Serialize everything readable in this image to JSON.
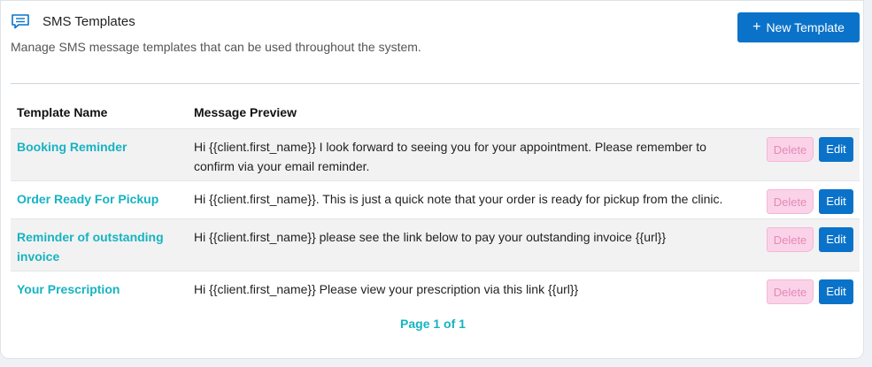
{
  "header": {
    "title": "SMS Templates",
    "subtitle": "Manage SMS message templates that can be used throughout the system.",
    "new_button_label": "New Template",
    "new_button_icon": "plus-icon",
    "title_icon": "message-icon"
  },
  "table": {
    "columns": [
      "Template Name",
      "Message Preview"
    ],
    "rows": [
      {
        "name": "Booking Reminder",
        "preview": "Hi {{client.first_name}} I look forward to seeing you for your appointment. Please remember to confirm via your email reminder.",
        "delete_label": "Delete",
        "edit_label": "Edit"
      },
      {
        "name": "Order Ready For Pickup",
        "preview": "Hi {{client.first_name}}. This is just a quick note that your order is ready for pickup from the clinic.",
        "delete_label": "Delete",
        "edit_label": "Edit"
      },
      {
        "name": "Reminder of outstanding invoice",
        "preview": "Hi {{client.first_name}} please see the link below to pay your outstanding invoice {{url}}",
        "delete_label": "Delete",
        "edit_label": "Edit"
      },
      {
        "name": "Your Prescription",
        "preview": "Hi {{client.first_name}} Please view your prescription via this link {{url}}",
        "delete_label": "Delete",
        "edit_label": "Edit"
      }
    ]
  },
  "pagination": {
    "label": "Page 1 of 1"
  },
  "colors": {
    "accent": "#0a73c9",
    "link": "#16b3c2",
    "delete_bg": "#fbd3e9"
  }
}
